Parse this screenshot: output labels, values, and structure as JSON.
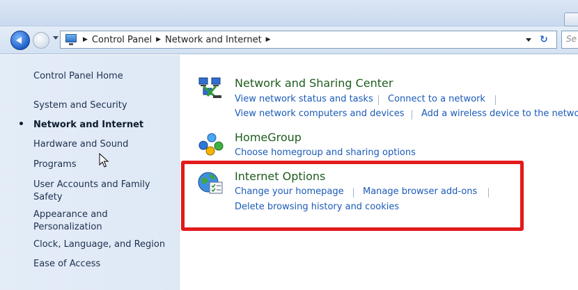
{
  "address_bar": {
    "crumbs": [
      "Control Panel",
      "Network and Internet"
    ],
    "search_placeholder": "Se"
  },
  "left_pane": {
    "home": "Control Panel Home",
    "items": [
      "System and Security",
      "Network and Internet",
      "Hardware and Sound",
      "Programs",
      "User Accounts and Family",
      "Safety",
      "Appearance and",
      "Personalization",
      "Clock, Language, and Region",
      "Ease of Access"
    ]
  },
  "content": {
    "network_sharing": {
      "title": "Network and Sharing Center",
      "links": [
        "View network status and tasks",
        "Connect to a network",
        "View network computers and devices",
        "Add a wireless device to the netwo"
      ]
    },
    "homegroup": {
      "title": "HomeGroup",
      "links": [
        "Choose homegroup and sharing options"
      ]
    },
    "internet_options": {
      "title": "Internet Options",
      "links": [
        "Change your homepage",
        "Manage browser add-ons",
        "Delete browsing history and cookies"
      ]
    }
  },
  "colors": {
    "category_title": "#1e5c1e",
    "link": "#1a5ab8",
    "highlight_box": "#e21a1a"
  },
  "icons": [
    "back-arrow-icon",
    "forward-arrow-icon",
    "control-panel-icon",
    "refresh-icon",
    "network-icon",
    "homegroup-icon",
    "internet-options-icon",
    "mouse-cursor-icon"
  ]
}
